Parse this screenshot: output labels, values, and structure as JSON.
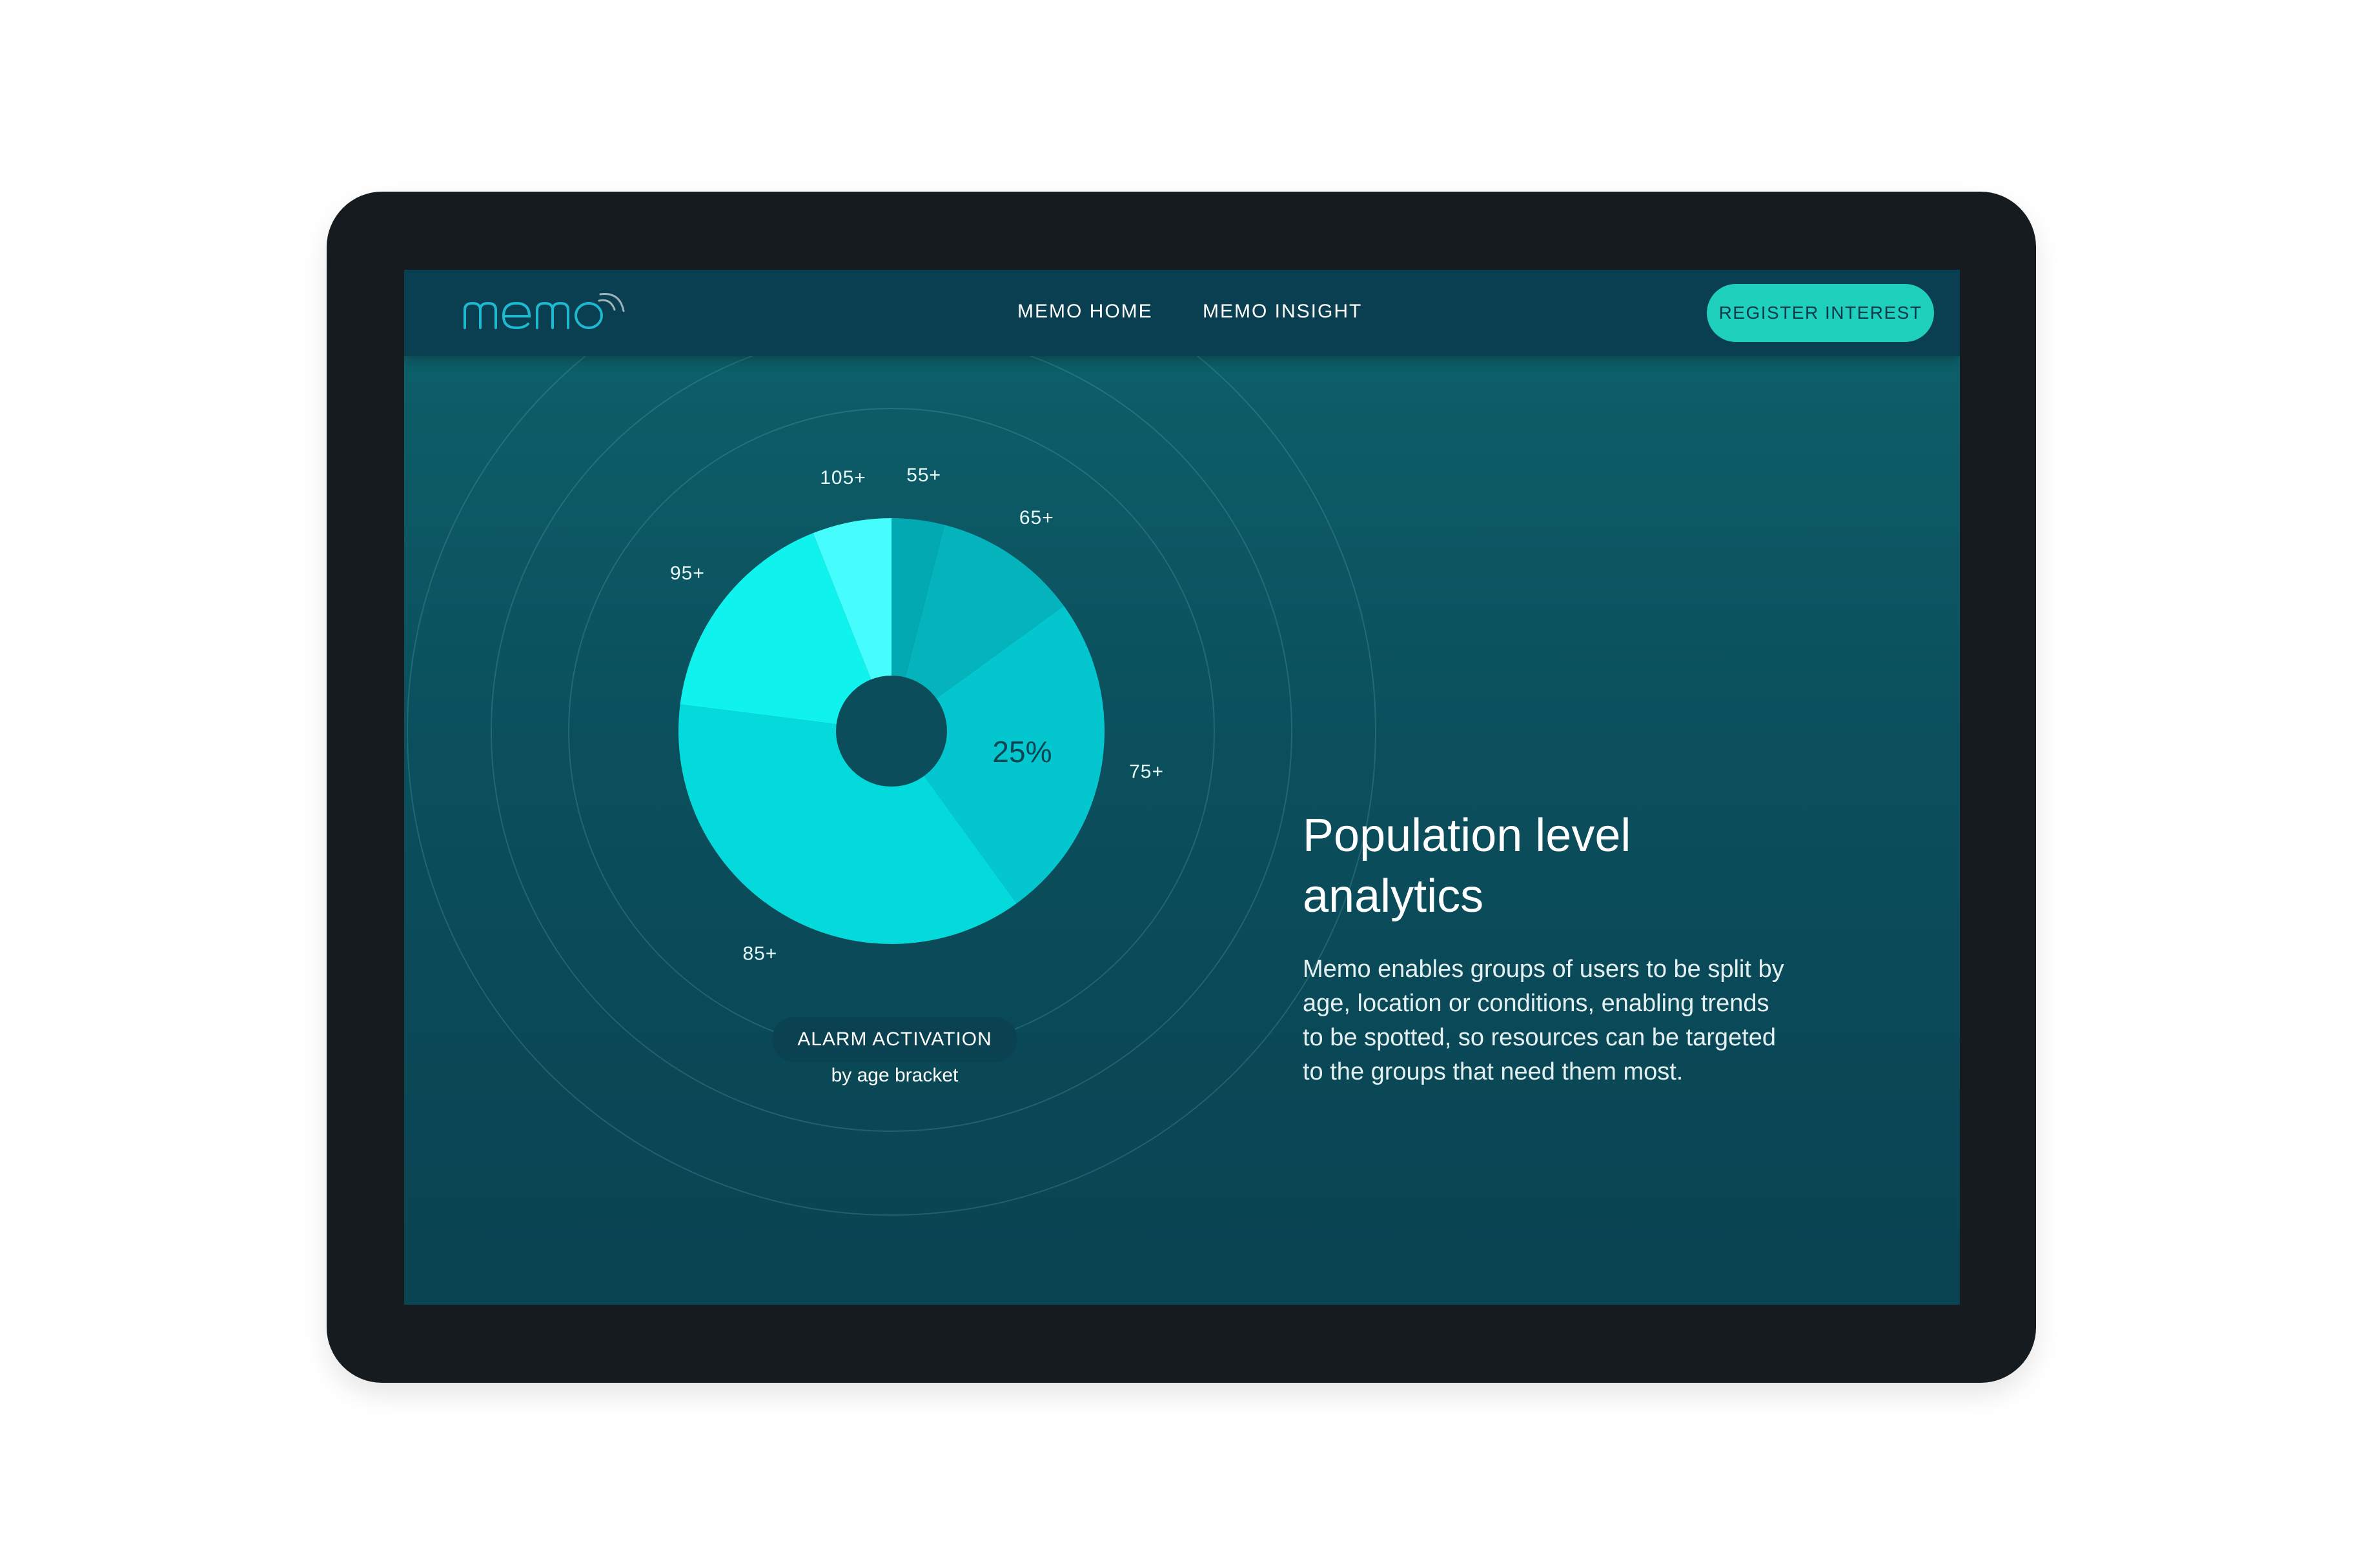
{
  "brand": {
    "logo_text": "memo"
  },
  "nav": {
    "links": [
      {
        "label": "MEMO HOME"
      },
      {
        "label": "MEMO INSIGHT"
      }
    ],
    "cta_label": "REGISTER INTEREST"
  },
  "chart": {
    "title": "ALARM ACTIVATION",
    "subtitle": "by age bracket",
    "highlight_label": "25%"
  },
  "content": {
    "heading_line1": "Population level",
    "heading_line2": "analytics",
    "body": "Memo enables groups of users to be split by age, location or conditions, enabling trends to be spotted, so resources can be targeted to the groups that need them most."
  },
  "chart_data": {
    "type": "pie",
    "title": "ALARM ACTIVATION",
    "subtitle": "by age bracket",
    "slices": [
      {
        "label": "55+",
        "value": 4,
        "color": "#02a8b2"
      },
      {
        "label": "65+",
        "value": 11,
        "color": "#04b3bc"
      },
      {
        "label": "75+",
        "value": 25,
        "color": "#03c6cf"
      },
      {
        "label": "85+",
        "value": 37,
        "color": "#04d9dc"
      },
      {
        "label": "95+",
        "value": 17,
        "color": "#0ff2ee"
      },
      {
        "label": "105+",
        "value": 6,
        "color": "#46fdfd"
      }
    ],
    "highlight": {
      "label": "75+",
      "text": "25%"
    }
  },
  "colors": {
    "device": "#151b1f",
    "navbar": "#093f51",
    "accent": "#1fd1bd",
    "screen_top": "#0d626b",
    "screen_bottom": "#0a4352"
  }
}
